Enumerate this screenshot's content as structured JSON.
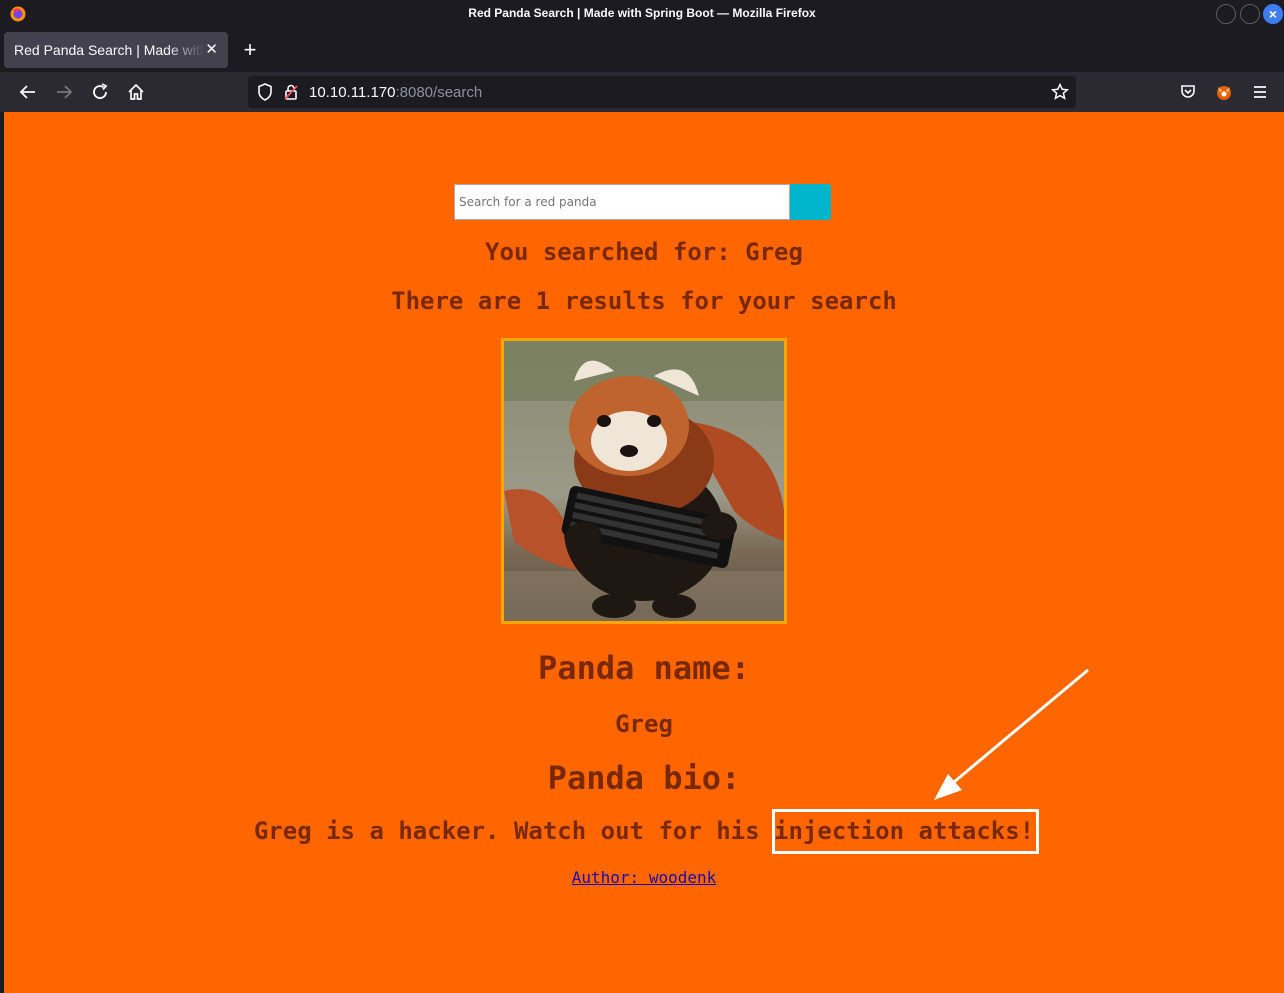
{
  "window": {
    "title": "Red Panda Search | Made with Spring Boot — Mozilla Firefox"
  },
  "tabs": [
    {
      "label": "Red Panda Search | Made with Spring Boot"
    }
  ],
  "urlbar": {
    "host": "10.10.11.170",
    "rest": ":8080/search"
  },
  "search": {
    "placeholder": "Search for a red panda",
    "value": ""
  },
  "results": {
    "searched_for": "You searched for: Greg",
    "count_text": "There are 1 results for your search"
  },
  "panda": {
    "name_heading": "Panda name:",
    "name": "Greg",
    "bio_heading": "Panda bio:",
    "bio": "Greg is a hacker. Watch out for his injection attacks!",
    "author": "Author: woodenk"
  },
  "colors": {
    "page_bg": "#ff6600",
    "text": "#7a2800",
    "search_button": "#00b4cc",
    "image_border": "#ffa500",
    "annotation": "#ffffff"
  }
}
